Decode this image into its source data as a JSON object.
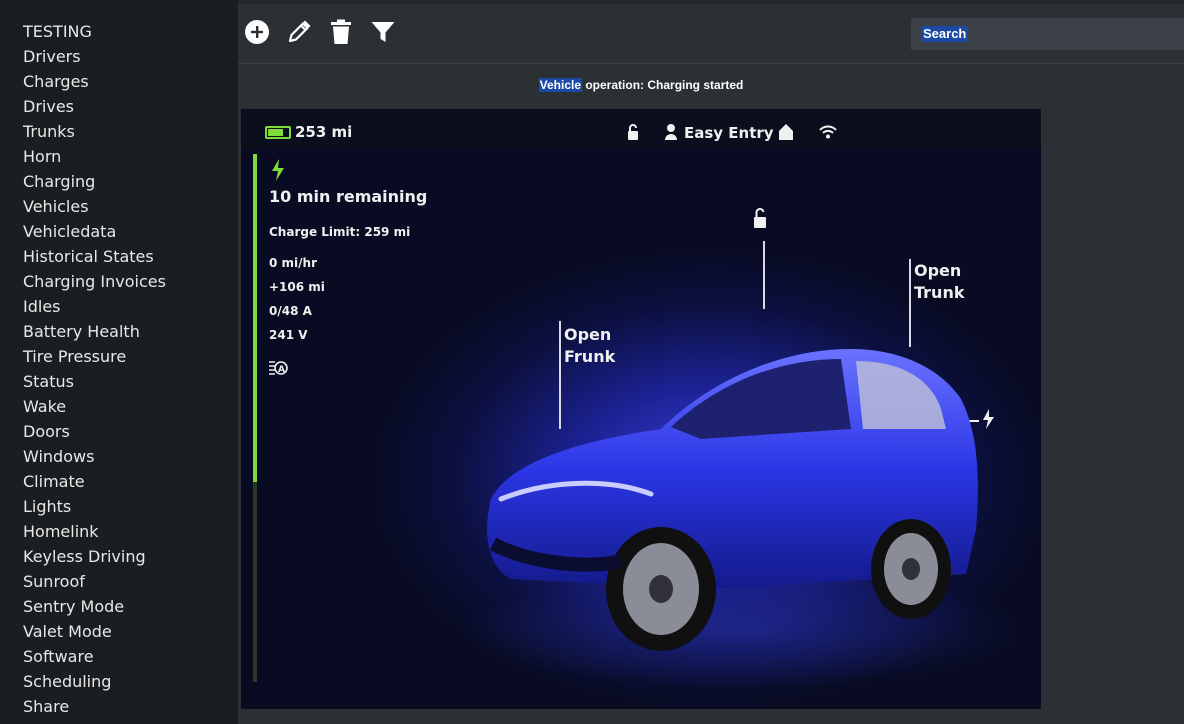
{
  "sidebar": {
    "items": [
      "TESTING",
      "Drivers",
      "Charges",
      "Drives",
      "Trunks",
      "Horn",
      "Charging",
      "Vehicles",
      "Vehicledata",
      "Historical States",
      "Charging Invoices",
      "Idles",
      "Battery Health",
      "Tire Pressure",
      "Status",
      "Wake",
      "Doors",
      "Windows",
      "Climate",
      "Lights",
      "Homelink",
      "Keyless Driving",
      "Sunroof",
      "Sentry Mode",
      "Valet Mode",
      "Software",
      "Scheduling",
      "Share"
    ]
  },
  "toolbar": {
    "icons": [
      "add-icon",
      "edit-icon",
      "delete-icon",
      "filter-icon"
    ],
    "search_label": "Search"
  },
  "status": {
    "highlight": "Vehicle",
    "rest": " operation: Charging started"
  },
  "vehicle_screen": {
    "range": "253 mi",
    "mode": "Easy Entry",
    "time_remaining": "10 min remaining",
    "charge_limit": "Charge Limit: 259 mi",
    "rate": "0 mi/hr",
    "added": "+106 mi",
    "current": "0/48 A",
    "voltage": "241 V",
    "frunk_label_1": "Open",
    "frunk_label_2": "Frunk",
    "trunk_label_1": "Open",
    "trunk_label_2": "Trunk",
    "colors": {
      "charge_green": "#7edc3a",
      "car_blue": "#2b36e6",
      "highlight": "#1a4aa6"
    }
  }
}
